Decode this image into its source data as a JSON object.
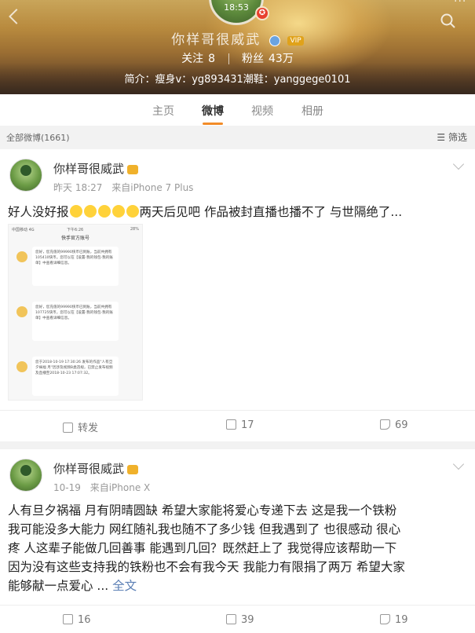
{
  "profile": {
    "status_time": "18:53",
    "name": "你样哥很威武",
    "vip_label": "VIP",
    "follow_label": "关注",
    "follow_count": "8",
    "fans_label": "粉丝",
    "fans_count": "43万",
    "bio": "简介：瘦身v：yg893431潮鞋：yanggege0101"
  },
  "tabs": [
    "主页",
    "微博",
    "视频",
    "相册"
  ],
  "active_tab": "微博",
  "filter_bar": {
    "count_label": "全部微博(1661)",
    "filter_label": "筛选"
  },
  "posts": [
    {
      "user": "你样哥很威武",
      "time": "昨天 18:27",
      "source": "来自iPhone 7 Plus",
      "text_before_emoji": "好人没好报",
      "emoji_count": 5,
      "text_after_emoji": "两天后见吧 作品被封直播也播不了 与世隔绝了...",
      "screenshot": {
        "title": "快手官方账号",
        "statusbar_carrier": "中国移动 4G",
        "statusbar_time": "下午6:26",
        "statusbar_battery": "28%",
        "messages": [
          "您好，您充值的99990快币已到账，当前共拥有105410快币。您可以在【设置-我的钱包-我的账单】中查看详细信息。",
          "您好，您充值的99990快币已到账，当前共拥有107725快币，您可以在【设置-我的钱包-我的账单】中查看详细信息。",
          "您于2018-10-19 17:30:26 发布的作品\"人有旦夕祸福 月\"因涉及视频B类违规，已禁止发布视频及直播至2018-10-23 17:07:32。"
        ]
      },
      "actions": {
        "repost": "转发",
        "comments": "17",
        "likes": "69"
      }
    },
    {
      "user": "你样哥很威武",
      "time": "10-19",
      "source": "来自iPhone X",
      "lines": [
        "人有旦夕祸福 月有阴晴圆缺 希望大家能将爱心专递下去 这是我一个铁粉",
        "我可能没多大能力 网红随礼我也随不了多少钱 但我遇到了 也很感动 很心",
        "疼 人这辈子能做几回善事 能遇到几回？既然赶上了 我觉得应该帮助一下",
        "因为没有这些支持我的铁粉也不会有我今天 我能力有限捐了两万 希望大家",
        "能够献一点爱心 ..."
      ],
      "full_text_link": "全文",
      "actions": {
        "repost": "16",
        "comments": "39",
        "likes": "19"
      }
    }
  ],
  "colors": {
    "tab_accent": "#f28c28",
    "link": "#5b7fb5"
  }
}
